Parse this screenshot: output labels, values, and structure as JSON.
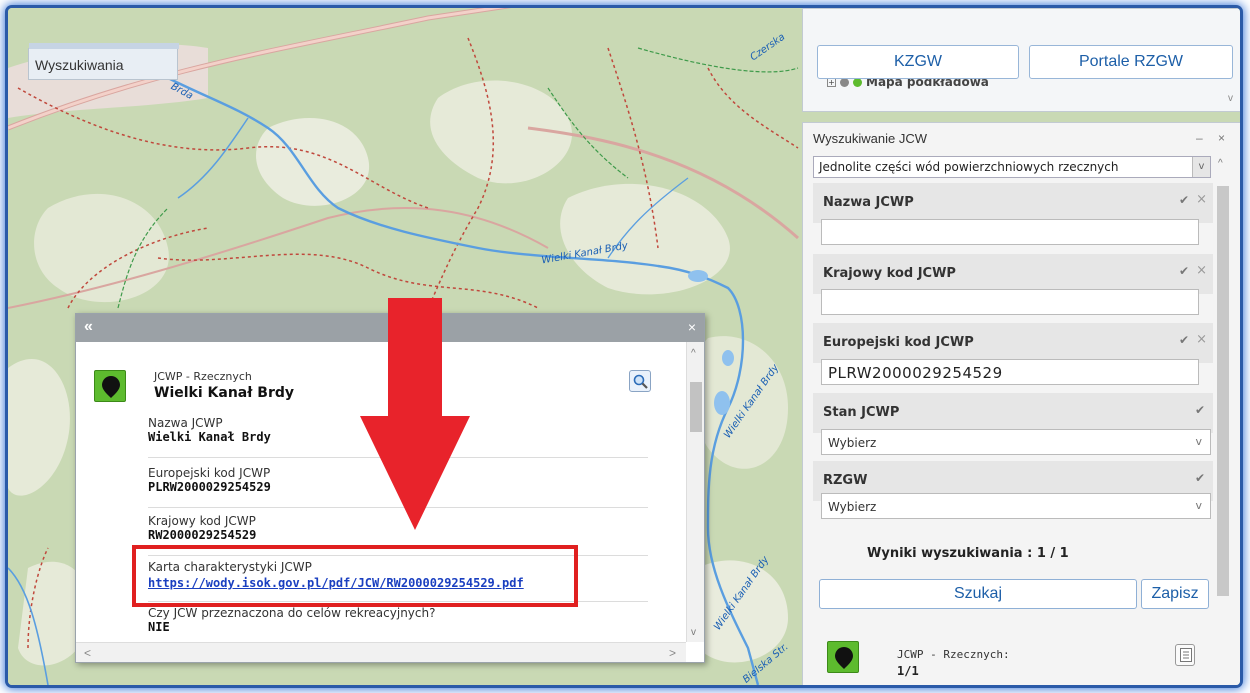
{
  "map": {
    "tab_label": "Wyszukiwania",
    "labels": [
      "Brda",
      "Wielki Kanał Brdy",
      "Wielki Kanał Brdy",
      "Wielki Kanał Brdy",
      "Bielska Str.",
      "Czerska"
    ]
  },
  "popup": {
    "collapse": "«",
    "close": "×",
    "type": "JCWP - Rzecznych",
    "name": "Wielki Kanał Brdy",
    "attributes": [
      {
        "key": "Nazwa JCWP",
        "value": "Wielki Kanał Brdy"
      },
      {
        "key": "Europejski kod JCWP",
        "value": "PLRW2000029254529"
      },
      {
        "key": "Krajowy kod JCWP",
        "value": "RW2000029254529"
      },
      {
        "key": "Karta charakterystyki JCWP",
        "value": "https://wody.isok.gov.pl/pdf/JCW/RW2000029254529.pdf"
      },
      {
        "key": "Czy JCW przeznaczona do celów rekreacyjnych?",
        "value": "NIE"
      }
    ]
  },
  "top_panel": {
    "buttons": [
      "KZGW",
      "Portale RZGW"
    ],
    "layers": [
      "Mapa podkładowa"
    ]
  },
  "search_panel": {
    "title": "Wyszukiwanie JCW",
    "controls": "– ×",
    "type_select": "Jednolite części wód powierzchniowych rzecznych",
    "fields": [
      {
        "label": "Nazwa JCWP",
        "value": ""
      },
      {
        "label": "Krajowy kod JCWP",
        "value": ""
      },
      {
        "label": "Europejski kod JCWP",
        "value": "PLRW2000029254529"
      }
    ],
    "selects": [
      {
        "label": "Stan JCWP",
        "value": "Wybierz"
      },
      {
        "label": "RZGW",
        "value": "Wybierz"
      }
    ],
    "results": "Wyniki wyszukiwania : 1 / 1",
    "search_button": "Szukaj",
    "save_button": "Zapisz",
    "result_item": {
      "type": "JCWP - Rzecznych:",
      "count": "1/1"
    }
  },
  "colors": {
    "frame": "#3c78d8",
    "accent": "#1d5fa8",
    "highlight": "#e02020",
    "pin": "#5dbb2e"
  }
}
